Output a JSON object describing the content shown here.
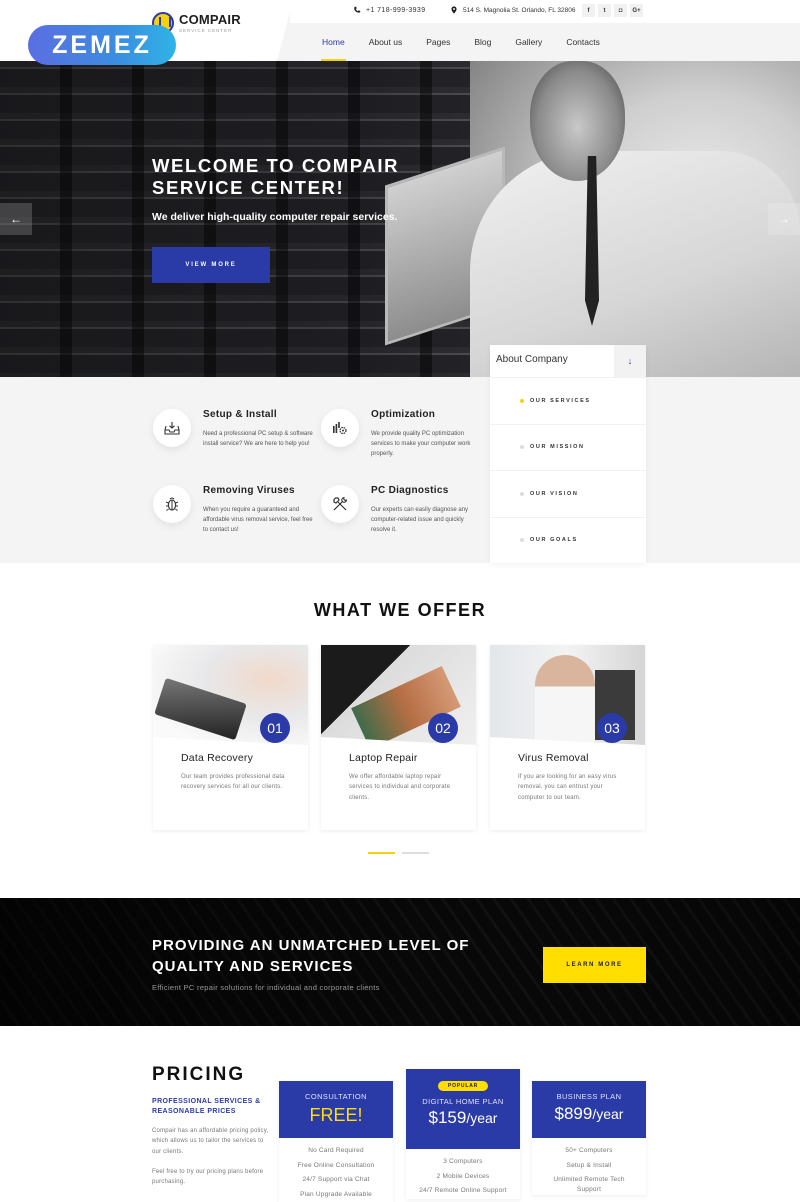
{
  "brand": {
    "name": "COMPAIR",
    "tagline": "SERVICE CENTER",
    "watermark": "ZEMEZ"
  },
  "topbar": {
    "phone": "+1 718-999-3939",
    "address": "514 S. Magnolia St. Orlando, FL 32806",
    "socials": [
      {
        "icon": "facebook-icon",
        "glyph": "f"
      },
      {
        "icon": "twitter-icon",
        "glyph": "t"
      },
      {
        "icon": "instagram-icon",
        "glyph": "◘"
      },
      {
        "icon": "google-plus-icon",
        "glyph": "G+"
      }
    ]
  },
  "nav": {
    "items": [
      {
        "label": "Home",
        "active": true
      },
      {
        "label": "About us"
      },
      {
        "label": "Pages"
      },
      {
        "label": "Blog"
      },
      {
        "label": "Gallery"
      },
      {
        "label": "Contacts"
      }
    ]
  },
  "hero": {
    "title_line1": "WELCOME TO COMPAIR",
    "title_line2": "SERVICE CENTER!",
    "subtitle": "We deliver high-quality computer repair services.",
    "button": "VIEW MORE",
    "prev_glyph": "←",
    "next_glyph": "→"
  },
  "services": [
    {
      "title": "Setup & Install",
      "text": "Need a professional PC setup & software install service? We are here to help you!",
      "icon": "inbox-download-icon"
    },
    {
      "title": "Optimization",
      "text": "We provide quality PC optimization services to make your computer work properly.",
      "icon": "chart-gear-icon"
    },
    {
      "title": "Removing Viruses",
      "text": "When you require a guaranteed and affordable virus removal service, feel free to contact us!",
      "icon": "bug-icon"
    },
    {
      "title": "PC Diagnostics",
      "text": "Our experts can easily diagnose any computer-related issue and quickly resolve it.",
      "icon": "tools-icon"
    }
  ],
  "about": {
    "title": "About Company",
    "toggle_glyph": "↓",
    "items": [
      {
        "label": "OUR SERVICES",
        "active": true
      },
      {
        "label": "OUR MISSION"
      },
      {
        "label": "OUR VISION"
      },
      {
        "label": "OUR GOALS"
      }
    ]
  },
  "offer": {
    "title": "WHAT WE OFFER",
    "cards": [
      {
        "num": "01",
        "title": "Data Recovery",
        "text": "Our team provides professional data recovery services for all our clients."
      },
      {
        "num": "02",
        "title": "Laptop Repair",
        "text": "We offer affordable laptop repair services to individual and corporate clients."
      },
      {
        "num": "03",
        "title": "Virus Removal",
        "text": "If you are looking for an easy virus removal, you can entrust your computer to our team."
      }
    ],
    "pagination": {
      "pages": 2,
      "active": 1
    }
  },
  "quality": {
    "title": "PROVIDING AN UNMATCHED LEVEL OF QUALITY AND SERVICES",
    "subtitle": "Efficient PC repair solutions for individual and corporate clients",
    "button": "LEARN MORE"
  },
  "pricing": {
    "title": "PRICING",
    "subtitle": "PROFESSIONAL SERVICES & REASONABLE PRICES",
    "text1": "Compair has an affordable pricing policy, which allows us to tailor the services to our clients.",
    "text2": "Feel free to try our pricing plans before purchasing.",
    "plans": [
      {
        "name": "CONSULTATION",
        "price": "FREE!",
        "per": "",
        "features": [
          "No Card Required",
          "Free Online Consultation",
          "24/7 Support via Chat",
          "Plan Upgrade Available"
        ]
      },
      {
        "badge": "POPULAR",
        "name": "DIGITAL HOME PLAN",
        "price": "$159",
        "per": "/year",
        "features": [
          "3 Computers",
          "2 Mobile Devices",
          "24/7 Remote Online Support"
        ]
      },
      {
        "name": "BUSINESS PLAN",
        "price": "$899",
        "per": "/year",
        "features": [
          "50+ Computers",
          "Setup & Install",
          "Unlimited Remote Tech Support"
        ]
      }
    ]
  },
  "colors": {
    "primary": "#2a3aa6",
    "accent": "#ffde00",
    "light_bg": "#f4f4f4"
  }
}
